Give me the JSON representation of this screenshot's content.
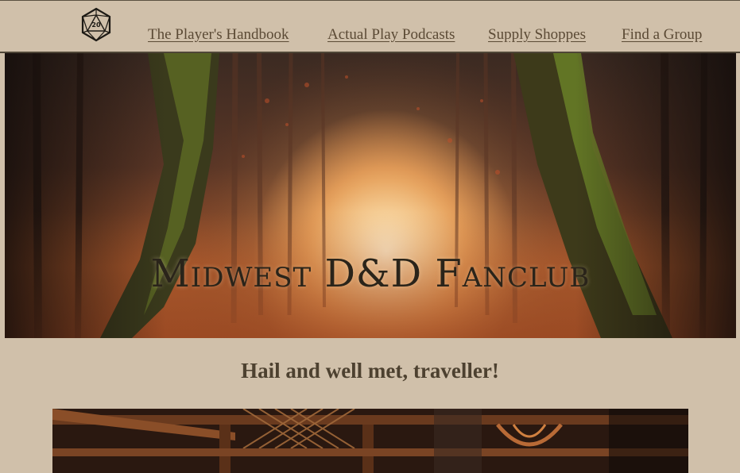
{
  "nav": {
    "logo_label": "20",
    "links": [
      {
        "label": "The Player's Handbook"
      },
      {
        "label": "Actual Play Podcasts"
      },
      {
        "label": "Supply Shoppes"
      },
      {
        "label": "Find a Group"
      }
    ]
  },
  "hero": {
    "title": "Midwest D&D Fanclub"
  },
  "main": {
    "greeting": "Hail and well met, traveller!"
  }
}
